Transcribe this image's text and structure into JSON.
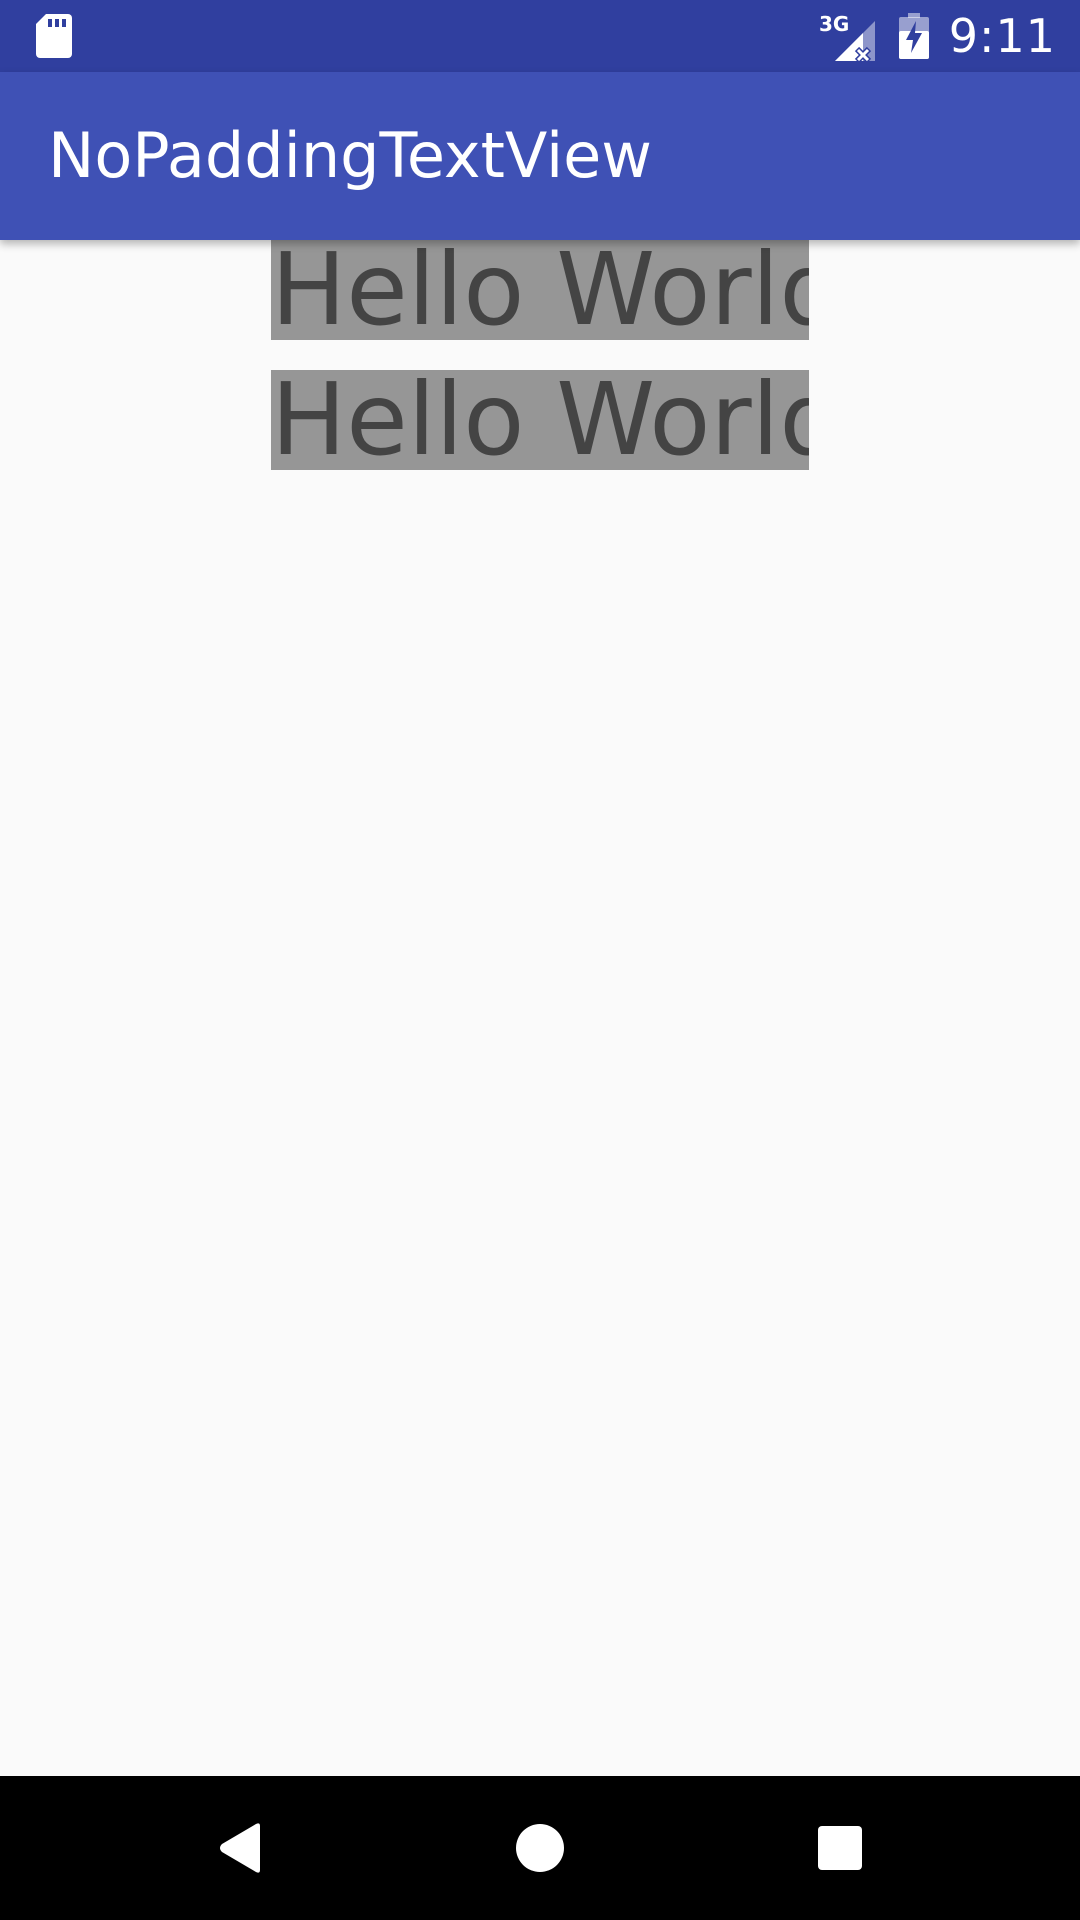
{
  "status_bar": {
    "network_label": "3G",
    "time": "9:11",
    "icons": [
      "sd-card-icon",
      "signal-no-data-icon",
      "battery-charging-icon"
    ]
  },
  "app_bar": {
    "title": "NoPaddingTextView"
  },
  "content": {
    "text_views": [
      {
        "text": "Hello World!"
      },
      {
        "text": "Hello World!"
      }
    ]
  },
  "nav_bar": {
    "buttons": [
      "back-icon",
      "home-icon",
      "recents-icon"
    ]
  },
  "colors": {
    "status_bar": "#303F9F",
    "app_bar": "#3F51B5",
    "text_view_background": "#969696",
    "text_view_text": "#444444",
    "background": "#fafafa",
    "nav_bar": "#000000"
  }
}
